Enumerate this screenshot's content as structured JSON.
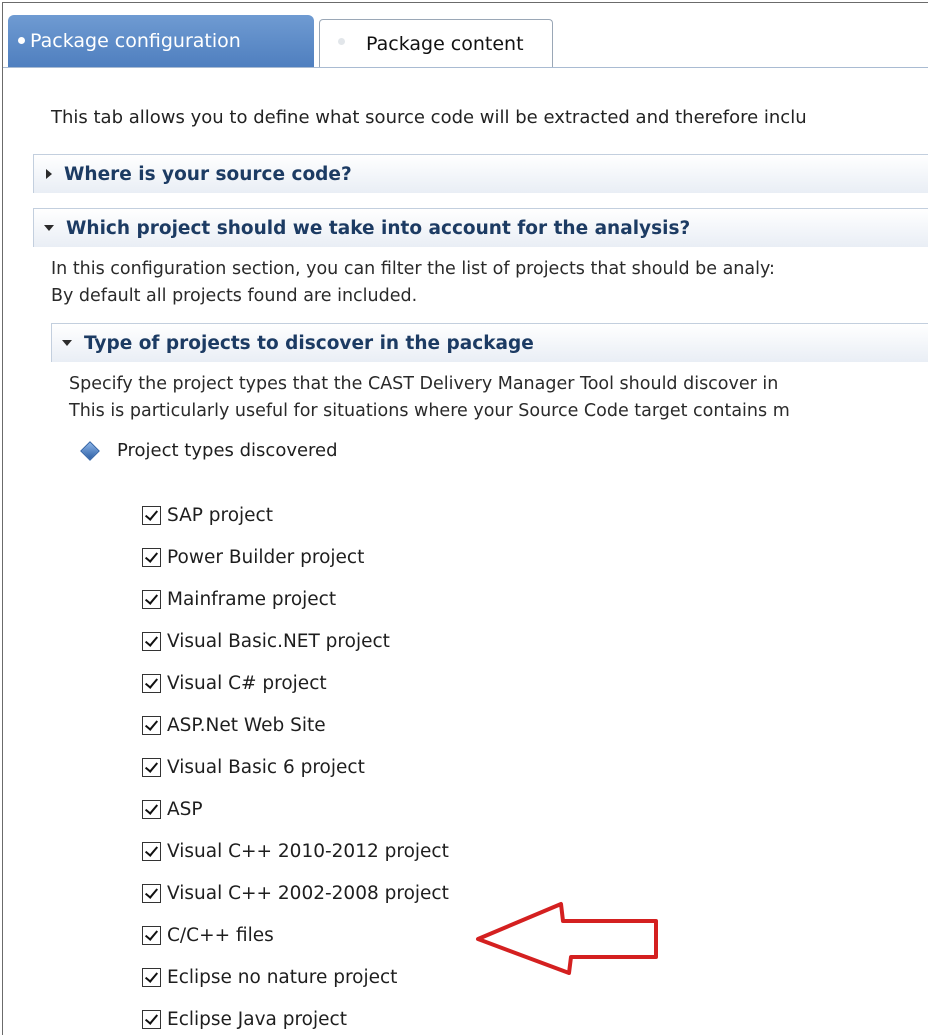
{
  "tabs": {
    "active_label": "Package configuration",
    "inactive_label": "Package content"
  },
  "intro_text": "This tab allows you to define what source code will be extracted and therefore inclu",
  "sections": {
    "source": {
      "title": "Where is your source code?"
    },
    "projects": {
      "title": "Which project should we take into account for the analysis?",
      "desc_line1": "In this configuration section, you can filter the list of projects that should be analy:",
      "desc_line2": "By default all projects found are included."
    },
    "types": {
      "title": "Type of projects to discover in the package",
      "desc_line1": "Specify the project types that the CAST Delivery Manager Tool should discover in",
      "desc_line2": "This is particularly useful for situations where your Source Code target contains m"
    }
  },
  "group_label": "Project types discovered",
  "project_types": [
    {
      "label": "SAP project",
      "checked": true
    },
    {
      "label": "Power Builder project",
      "checked": true
    },
    {
      "label": "Mainframe project",
      "checked": true
    },
    {
      "label": "Visual Basic.NET project",
      "checked": true
    },
    {
      "label": "Visual C# project",
      "checked": true
    },
    {
      "label": "ASP.Net Web Site",
      "checked": true
    },
    {
      "label": "Visual Basic 6 project",
      "checked": true
    },
    {
      "label": "ASP",
      "checked": true
    },
    {
      "label": "Visual C++ 2010-2012 project",
      "checked": true
    },
    {
      "label": "Visual C++ 2002-2008 project",
      "checked": true
    },
    {
      "label": "C/C++ files",
      "checked": true
    },
    {
      "label": "Eclipse no nature project",
      "checked": true
    },
    {
      "label": "Eclipse Java project",
      "checked": true
    }
  ],
  "colors": {
    "tab_active": "#5b8ac8",
    "section_title": "#1c3b63",
    "annotation_arrow": "#d42020"
  }
}
